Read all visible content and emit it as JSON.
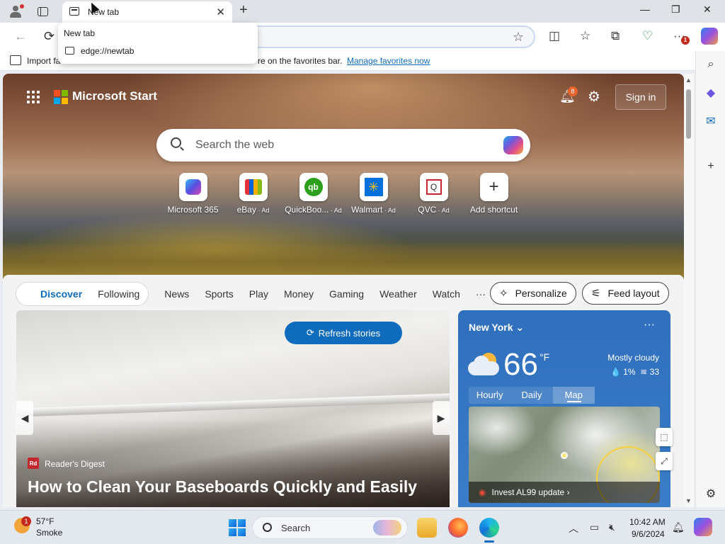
{
  "tab": {
    "title": "New tab",
    "close": "✕"
  },
  "window": {
    "new_tab": "+",
    "minimize": "—",
    "restore": "❐",
    "close": "✕"
  },
  "suggestions": {
    "item1": "New tab",
    "item2": "edge://newtab"
  },
  "favorites_bar": {
    "text_start": "Import fa",
    "text_end": "re on the favorites bar.",
    "link": "Manage favorites now"
  },
  "header": {
    "brand": "Microsoft Start",
    "notifications_count": "8",
    "sign_in": "Sign in"
  },
  "search": {
    "placeholder": "Search the web"
  },
  "shortcuts": [
    {
      "label": "Microsoft 365",
      "ad": ""
    },
    {
      "label": "eBay",
      "ad": " · Ad"
    },
    {
      "label": "QuickBoo...",
      "ad": " · Ad"
    },
    {
      "label": "Walmart",
      "ad": " · Ad"
    },
    {
      "label": "QVC",
      "ad": " · Ad"
    },
    {
      "label": "Add shortcut",
      "ad": ""
    }
  ],
  "feed_nav": {
    "pills": [
      "Discover",
      "Following"
    ],
    "items": [
      "News",
      "Sports",
      "Play",
      "Money",
      "Gaming",
      "Weather",
      "Watch",
      "···"
    ],
    "personalize": "Personalize",
    "feed_layout": "Feed layout"
  },
  "story": {
    "refresh": "Refresh stories",
    "source": "Reader's Digest",
    "source_logo": "Rd",
    "headline": "How to Clean Your Baseboards Quickly and Easily"
  },
  "weather": {
    "city": "New York",
    "temperature": "66",
    "unit": "°F",
    "condition": "Mostly cloudy",
    "precip": "💧 1%",
    "aqi": "33",
    "tabs": [
      "Hourly",
      "Daily",
      "Map"
    ],
    "active_tab": "Map",
    "alert": "Invest AL99 update ›"
  },
  "taskbar": {
    "weather_temp": "57°F",
    "weather_cond": "Smoke",
    "weather_badge": "1",
    "search_label": "Search",
    "time": "10:42 AM",
    "date": "9/6/2024"
  },
  "colors": {
    "accent": "#0f6cbd",
    "weather_card": "#2f6fbd",
    "alert_red": "#c42b1c"
  }
}
